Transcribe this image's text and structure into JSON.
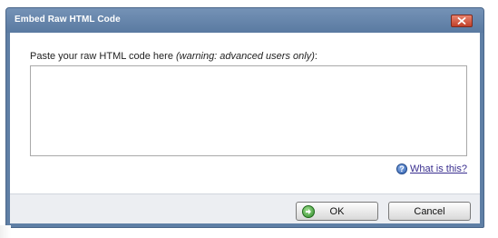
{
  "window": {
    "title": "Embed Raw HTML Code"
  },
  "prompt": {
    "text": "Paste your raw HTML code here ",
    "warning": "(warning: advanced users only)",
    "suffix": ":"
  },
  "code_input": {
    "value": ""
  },
  "help": {
    "link_text": "What is this?"
  },
  "buttons": {
    "ok_label": "OK",
    "cancel_label": "Cancel"
  },
  "icons": {
    "close": "close-icon",
    "help": "help-icon",
    "ok": "ok-arrow-icon"
  },
  "colors": {
    "titlebar": "#5f7fa5",
    "close_button": "#c0412a",
    "link": "#3a2f8f"
  }
}
